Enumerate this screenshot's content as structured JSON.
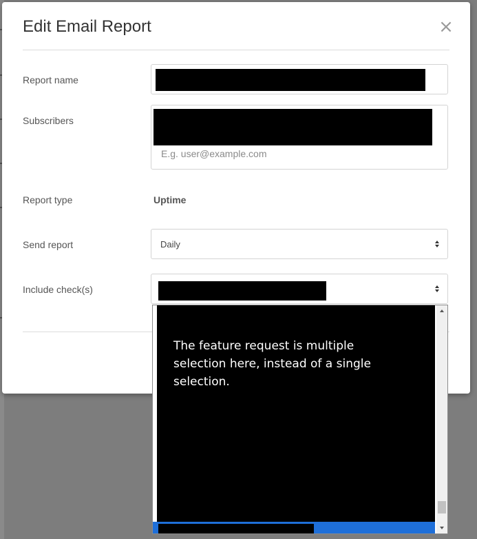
{
  "modal": {
    "title": "Edit Email Report",
    "close_label": "×"
  },
  "form": {
    "report_name_label": "Report name",
    "subscribers_label": "Subscribers",
    "subscribers_placeholder": "E.g. user@example.com",
    "report_type_label": "Report type",
    "report_type_value": "Uptime",
    "send_report_label": "Send report",
    "send_report_value": "Daily",
    "include_checks_label": "Include check(s)"
  },
  "dropdown": {
    "note": "The feature request is multiple selection here, instead of a single selection."
  },
  "colors": {
    "selected_option": "#1e6fd9",
    "primary_button_edge": "#4cae4c"
  }
}
